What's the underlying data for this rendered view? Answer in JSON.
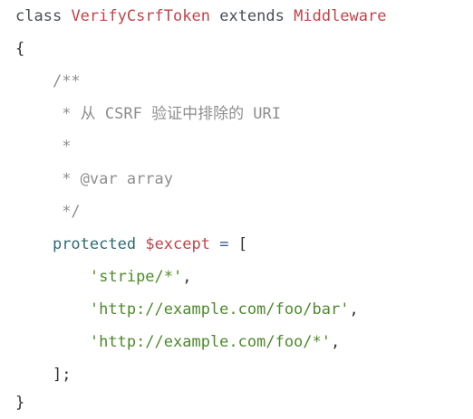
{
  "code": {
    "line1": {
      "keyword": "class",
      "class_name": "VerifyCsrfToken",
      "extends": "extends",
      "parent": "Middleware"
    },
    "line2": "{",
    "line3": "/**",
    "line4": " * 从 CSRF 验证中排除的 URI",
    "line5": " *",
    "line6": " * @var array",
    "line7": " */",
    "line8": {
      "keyword": "protected",
      "variable": "$except",
      "operator": "=",
      "bracket": "["
    },
    "line9": {
      "string": "'stripe/*'",
      "comma": ","
    },
    "line10": {
      "string": "'http://example.com/foo/bar'",
      "comma": ","
    },
    "line11": {
      "string": "'http://example.com/foo/*'",
      "comma": ","
    },
    "line12": "];",
    "line13": "}"
  },
  "colors": {
    "keyword": "#4a4f57",
    "class_name": "#c0444a",
    "comment": "#8e8e8e",
    "protected": "#2f6c73",
    "variable": "#c0444a",
    "operator": "#3a5c8e",
    "string": "#4d8a2b"
  }
}
